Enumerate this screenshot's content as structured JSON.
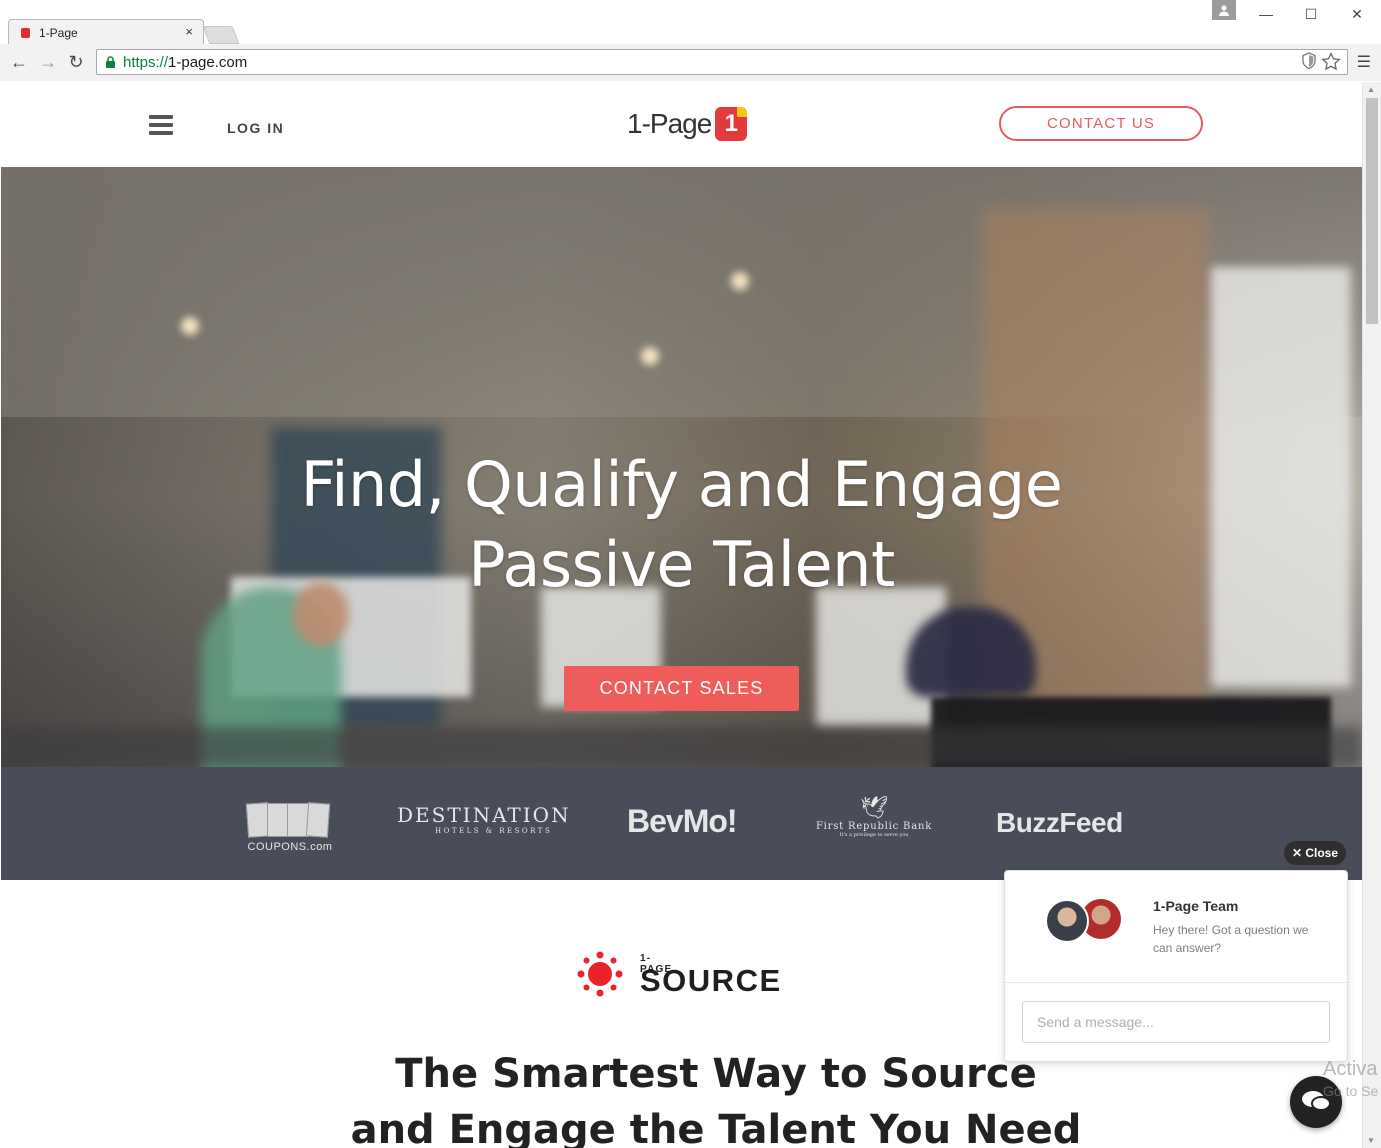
{
  "browser": {
    "tab_title": "1-Page",
    "tab_close": "×",
    "url_scheme": "https://",
    "url_host": "1-page.com",
    "minimize": "—",
    "maximize": "☐",
    "close": "✕",
    "back": "←",
    "forward": "→",
    "reload": "↻",
    "menu": "☰"
  },
  "header": {
    "login_label": "LOG IN",
    "logo_wordmark": "1-Page",
    "logo_mark": "1",
    "contact_label": "CONTACT US"
  },
  "hero": {
    "title_line1": "Find, Qualify and Engage",
    "title_line2": "Passive Talent",
    "cta_label": "CONTACT SALES"
  },
  "client_logos": {
    "coupons": "COUPONS.com",
    "destination_big": "DESTINATION",
    "destination_sub": "HOTELS & RESORTS",
    "bevmo": "BevMo!",
    "first_republic": "First Republic Bank",
    "first_republic_tag": "It's a privilege to serve you",
    "buzzfeed": "BuzzFeed"
  },
  "source": {
    "small_label": "1-PAGE",
    "big_label": "SOURCE",
    "tagline_line1": "The Smartest Way to Source",
    "tagline_line2": "and Engage the Talent You Need"
  },
  "chat": {
    "close_label": "Close",
    "team_name": "1-Page Team",
    "greeting": "Hey there! Got a question we can answer?",
    "input_placeholder": "Send a message..."
  },
  "os_watermark": {
    "line1": "Activa",
    "line2": "Go to Se"
  },
  "colors": {
    "accent": "#ef5d5a",
    "logo_bar": "#494d59"
  }
}
